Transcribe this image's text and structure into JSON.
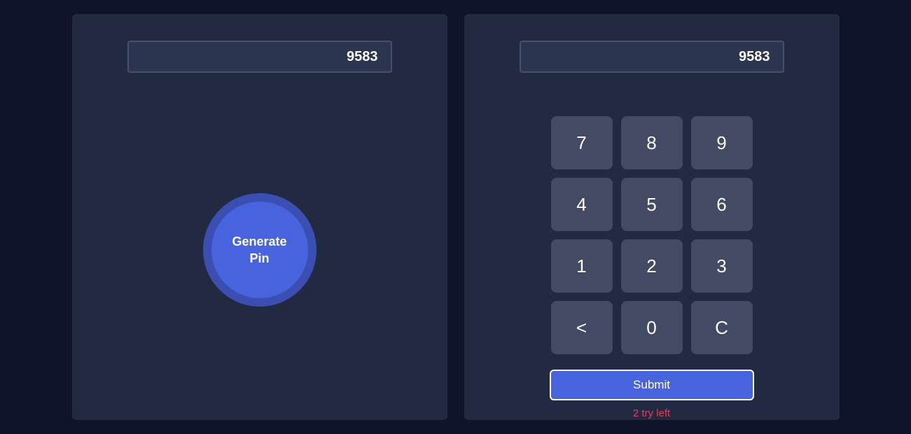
{
  "left": {
    "display_value": "9583",
    "generate_line1": "Generate",
    "generate_line2": "Pin"
  },
  "right": {
    "display_value": "9583",
    "keys": [
      "7",
      "8",
      "9",
      "4",
      "5",
      "6",
      "1",
      "2",
      "3",
      "<",
      "0",
      "C"
    ],
    "submit_label": "Submit",
    "status_text": "2 try left"
  }
}
